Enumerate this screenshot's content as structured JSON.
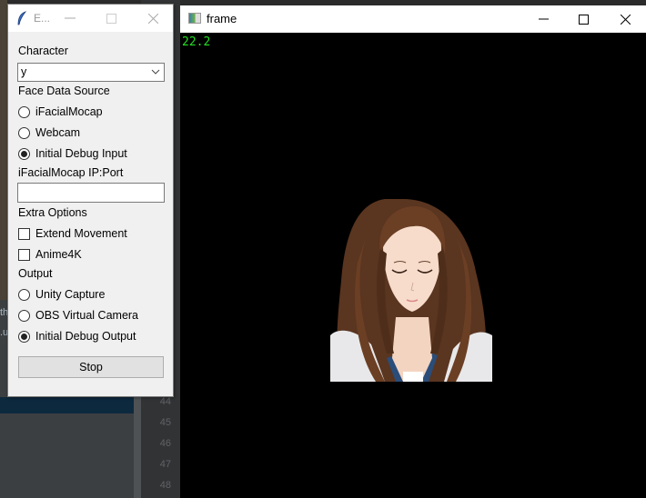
{
  "control_window": {
    "title": "E...",
    "title_icon": "feather-icon",
    "character": {
      "label": "Character",
      "selected": "y"
    },
    "face_data_source": {
      "label": "Face Data Source",
      "options": [
        {
          "label": "iFacialMocap",
          "selected": false
        },
        {
          "label": "Webcam",
          "selected": false
        },
        {
          "label": "Initial Debug Input",
          "selected": true
        }
      ]
    },
    "ip_port": {
      "label": "iFacialMocap IP:Port",
      "value": ""
    },
    "extra_options": {
      "label": "Extra Options",
      "options": [
        {
          "label": "Extend Movement",
          "checked": false
        },
        {
          "label": "Anime4K",
          "checked": false
        }
      ]
    },
    "output": {
      "label": "Output",
      "options": [
        {
          "label": "Unity Capture",
          "selected": false
        },
        {
          "label": "OBS Virtual Camera",
          "selected": false
        },
        {
          "label": "Initial Debug Output",
          "selected": true
        }
      ]
    },
    "stop_label": "Stop"
  },
  "frame_window": {
    "title": "frame",
    "fps": "22.2",
    "fps_color": "#22e022",
    "image": "anime-character-portrait"
  },
  "background_ide": {
    "line_numbers": [
      "44",
      "45",
      "46",
      "47",
      "48"
    ],
    "side_text": [
      "th",
      ".u"
    ]
  }
}
